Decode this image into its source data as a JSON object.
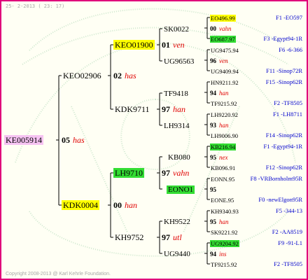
{
  "header": "25-  2-2013 ( 23: 17)",
  "footer": "Copyright 2008-2013 @ Karl Kehrle Foundation.",
  "colors": {
    "border": "#e0007a",
    "name_red": "#e00000",
    "info_blue": "#0000cc",
    "hl_pink": "#f6c3f2",
    "hl_yellow": "#ffff00",
    "hl_green": "#33dd33"
  },
  "root": {
    "id": "KE005914",
    "num": "05",
    "name": "has"
  },
  "gen2": [
    {
      "id": "KEO02906",
      "num": "02",
      "name": "has"
    },
    {
      "id": "KDK0004",
      "num": "00",
      "name": "han"
    }
  ],
  "gen3": [
    {
      "id": "KEO01900",
      "num": "01",
      "name": "ven"
    },
    {
      "id": "KDK9711",
      "num": "97",
      "name": "han"
    },
    {
      "id": "LH9710",
      "num": "97",
      "name": "vahn"
    },
    {
      "id": "KH9752",
      "num": "97",
      "name": "utl"
    }
  ],
  "gen4": [
    {
      "id": "SK0022"
    },
    {
      "id": "UG96563"
    },
    {
      "id": "TF9418"
    },
    {
      "id": "LH9314"
    },
    {
      "id": "KB080"
    },
    {
      "id": "EONO1"
    },
    {
      "id": "KH9522"
    },
    {
      "id": "UG9440"
    }
  ],
  "gen5": [
    {
      "num": "00",
      "name": "vahn",
      "sire": {
        "id": "EO496",
        "val": ".99",
        "info": "F1 -EO597"
      },
      "dam": {
        "id": "EO687",
        "val": ".97",
        "info": "F3 -Egypt94-1R"
      }
    },
    {
      "num": "96",
      "name": "ven",
      "sire": {
        "id": "UG9475",
        "val": ".94",
        "info": "F6 -6-366"
      },
      "dam": {
        "id": "UG9409",
        "val": ".94",
        "info": "F11 -Sinop72R"
      }
    },
    {
      "num": "94",
      "name": "han",
      "sire": {
        "id": "HN9211",
        "val": ".92",
        "info": "F15 -Sinop62R"
      },
      "dam": {
        "id": "TF9215",
        "val": ".92",
        "info": "F2 -TF8505"
      }
    },
    {
      "num": "93",
      "name": "han",
      "sire": {
        "id": "LH9220",
        "val": ".92",
        "info": "F1 -LH8711"
      },
      "dam": {
        "id": "LH9006",
        "val": ".90",
        "info": "F14 -Sinop62R"
      }
    },
    {
      "num": "95",
      "name": "nex",
      "sire": {
        "id": "KB216",
        "val": ".94",
        "info": "F1 -Egypt94-1R"
      },
      "dam": {
        "id": "KB096",
        "val": ".91",
        "info": "F12 -Sinop62R"
      }
    },
    {
      "num": "95",
      "name": "",
      "sire": {
        "id": "EONN",
        "val": ".95",
        "info": "F8 -VRBornholm95R"
      },
      "dam": {
        "id": "EONE",
        "val": ".95",
        "info": "F0 -newElgon95R"
      }
    },
    {
      "num": "95",
      "name": "han",
      "sire": {
        "id": "KH9340",
        "val": ".93",
        "info": "F5 -344-13"
      },
      "dam": {
        "id": "SK9221",
        "val": ".92",
        "info": "F2 -AA8519"
      }
    },
    {
      "num": "94",
      "name": "ins",
      "sire": {
        "id": "UG9204",
        "val": ".92",
        "info": "F9 -91-L1"
      },
      "dam": {
        "id": "TF9215",
        "val": ".92",
        "info": "F2 -TF8505"
      }
    }
  ]
}
